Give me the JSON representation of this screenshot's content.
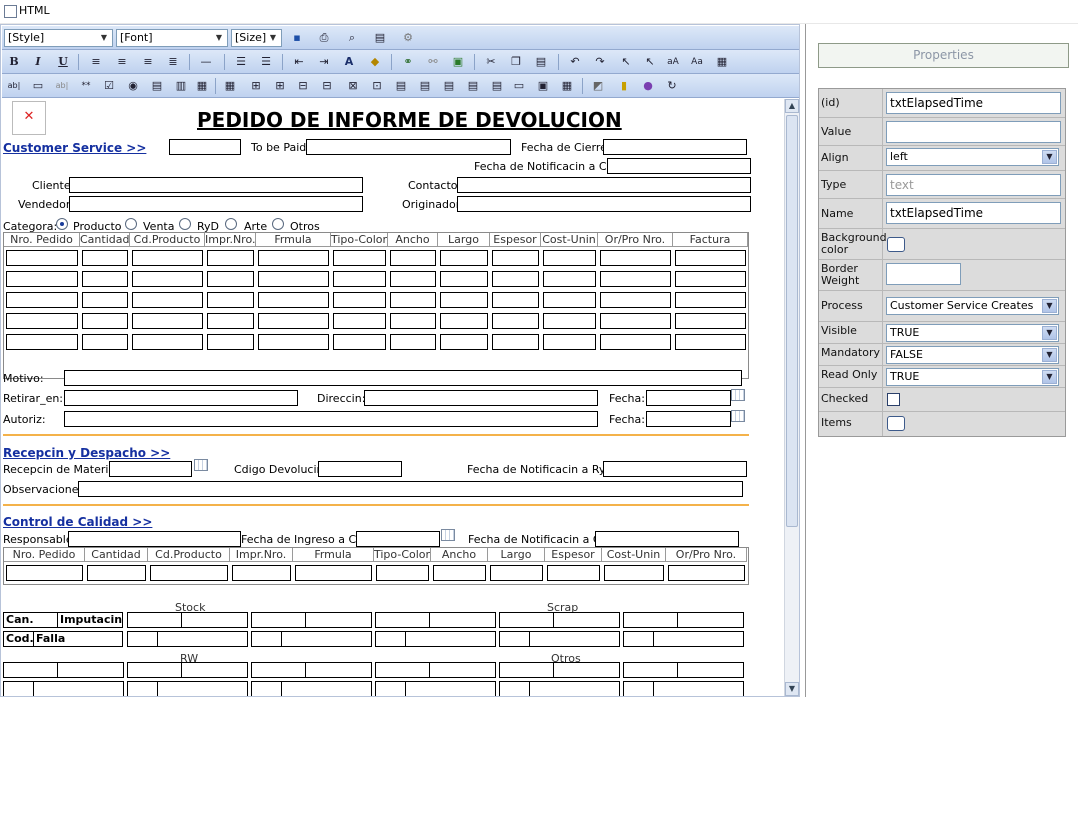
{
  "top": {
    "html_label": "HTML"
  },
  "toolbar": {
    "style": "[Style]",
    "font": "[Font]",
    "size": "[Size]",
    "bold": "B",
    "italic": "I",
    "underline": "U"
  },
  "form": {
    "title": "PEDIDO DE INFORME DE DEVOLUCION",
    "cs": {
      "header": "Customer Service >>",
      "to_be_paid": "To be Paid:",
      "fecha_cierre": "Fecha de Cierre:",
      "fecha_notif": "Fecha de Notificacin a CS.:",
      "cliente": "Cliente:",
      "contacto": "Contacto:",
      "vendedor": "Vendedor:",
      "originador": "Originador:",
      "categoria": "Categora:",
      "radios": [
        "Producto",
        "Venta",
        "RyD",
        "Arte",
        "Otros"
      ]
    },
    "grid1_headers": [
      "Nro. Pedido",
      "Cantidad",
      "Cd.Producto",
      "Impr.Nro.",
      "Frmula",
      "Tipo-Color",
      "Ancho",
      "Largo",
      "Espesor",
      "Cost-Unin",
      "Or/Pro Nro.",
      "Factura"
    ],
    "motivo": "Motivo:",
    "retirar": "Retirar_en:",
    "direccion": "Direccin:",
    "fecha": "Fecha:",
    "autoriz": "Autoriz:",
    "rd": {
      "header": "Recepcin y Despacho >>",
      "recepcion": "Recepcin de Material:",
      "codigo": "Cdigo Devolucin:",
      "fecha_notif": "Fecha de Notificacin a RyD:",
      "observaciones": "Observaciones:"
    },
    "cc": {
      "header": "Control de Calidad >>",
      "responsable": "Responsable:",
      "fecha_ingreso": "Fecha de Ingreso a CC:",
      "fecha_notif": "Fecha de Notificacin a CC:"
    },
    "grid2_headers": [
      "Nro. Pedido",
      "Cantidad",
      "Cd.Producto",
      "Impr.Nro.",
      "Frmula",
      "Tipo-Color",
      "Ancho",
      "Largo",
      "Espesor",
      "Cost-Unin",
      "Or/Pro Nro."
    ],
    "stock": "Stock",
    "scrap": "Scrap",
    "rw": "RW",
    "otros": "Otros",
    "can": "Can.",
    "imputacion": "Imputacin",
    "cod": "Cod.",
    "falla": "Falla"
  },
  "props": {
    "title": "Properties",
    "id": {
      "label": "(id)",
      "value": "txtElapsedTime"
    },
    "value": {
      "label": "Value",
      "value": ""
    },
    "align": {
      "label": "Align",
      "value": "left"
    },
    "type": {
      "label": "Type",
      "value": "text"
    },
    "name": {
      "label": "Name",
      "value": "txtElapsedTime"
    },
    "bgcolor": {
      "label": "Background color"
    },
    "border": {
      "label": "Border Weight",
      "value": ""
    },
    "process": {
      "label": "Process",
      "value": "Customer Service Creates"
    },
    "visible": {
      "label": "Visible",
      "value": "TRUE"
    },
    "mandatory": {
      "label": "Mandatory",
      "value": "FALSE"
    },
    "readonly": {
      "label": "Read Only",
      "value": "TRUE"
    },
    "checked": {
      "label": "Checked"
    },
    "items": {
      "label": "Items"
    }
  }
}
